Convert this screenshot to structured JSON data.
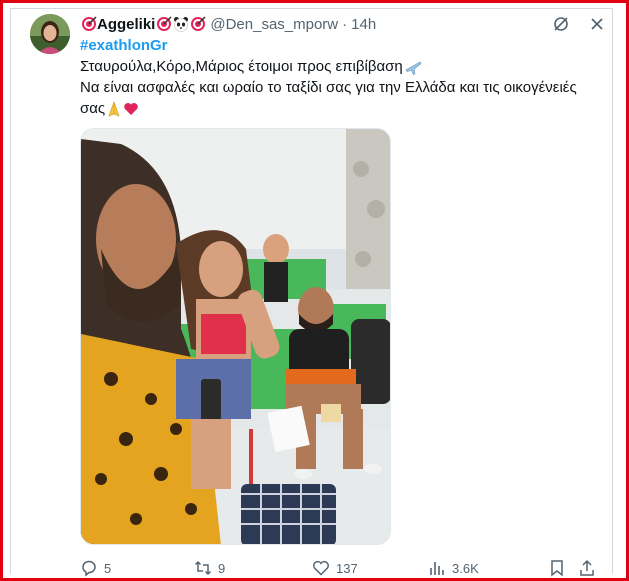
{
  "tweet": {
    "author_name": "Aggeliki",
    "handle": "@Den_sas_mporw",
    "separator": "·",
    "time": "14h",
    "hashtag": "#exathlonGr",
    "text_line1": "Σταυρούλα,Κόρο,Μάριος έτοιμοι προς επιβίβαση",
    "text_line2": "Να είναι ασφαλές και ωραίο το ταξίδι σας για την Ελλάδα και τις οικογένειές",
    "text_line3": "σας"
  },
  "actions": {
    "replies": "5",
    "retweets": "9",
    "likes": "137",
    "views": "3.6K"
  },
  "colors": {
    "frame": "#e0000f",
    "link": "#1d9bf0",
    "muted": "#536471"
  },
  "icons": [
    "target-emoji-icon",
    "panda-emoji-icon",
    "airplane-emoji-icon",
    "praying-hands-emoji-icon",
    "red-heart-emoji-icon",
    "grok-icon",
    "more-icon",
    "reply-icon",
    "retweet-icon",
    "like-icon",
    "views-icon",
    "bookmark-icon",
    "share-icon"
  ]
}
